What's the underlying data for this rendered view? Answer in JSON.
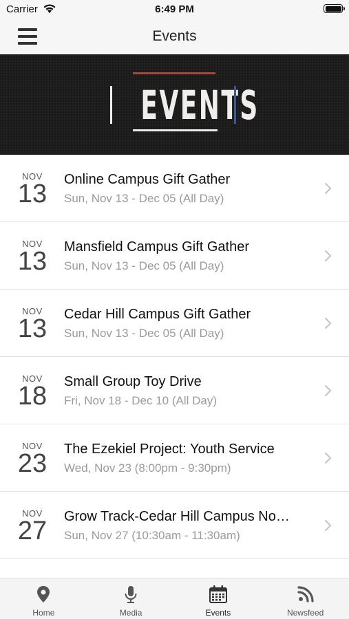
{
  "status_bar": {
    "carrier": "Carrier",
    "time": "6:49 PM"
  },
  "nav": {
    "title": "Events",
    "menu_icon": "hamburger-menu-icon"
  },
  "banner": {
    "word": "EVENTS"
  },
  "events": [
    {
      "month": "NOV",
      "day": "13",
      "title": "Online Campus Gift Gather",
      "subtitle": "Sun, Nov 13 - Dec 05 (All Day)"
    },
    {
      "month": "NOV",
      "day": "13",
      "title": "Mansfield Campus Gift Gather",
      "subtitle": "Sun, Nov 13 - Dec 05 (All Day)"
    },
    {
      "month": "NOV",
      "day": "13",
      "title": "Cedar Hill Campus Gift Gather",
      "subtitle": "Sun, Nov 13 - Dec 05 (All Day)"
    },
    {
      "month": "NOV",
      "day": "18",
      "title": "Small Group Toy Drive",
      "subtitle": "Fri, Nov 18 - Dec 10 (All Day)"
    },
    {
      "month": "NOV",
      "day": "23",
      "title": "The Ezekiel Project: Youth Service",
      "subtitle": "Wed, Nov 23 (8:00pm - 9:30pm)"
    },
    {
      "month": "NOV",
      "day": "27",
      "title": "Grow Track-Cedar Hill Campus No…",
      "subtitle": "Sun, Nov 27 (10:30am - 11:30am)"
    }
  ],
  "tabs": [
    {
      "label": "Home",
      "icon": "location-pin-icon",
      "active": false
    },
    {
      "label": "Media",
      "icon": "microphone-icon",
      "active": false
    },
    {
      "label": "Events",
      "icon": "calendar-icon",
      "active": true
    },
    {
      "label": "Newsfeed",
      "icon": "rss-feed-icon",
      "active": false
    }
  ],
  "colors": {
    "banner_bg": "#1b1b1b",
    "banner_red": "#b0442f",
    "banner_blue": "#3a5a93",
    "bar_bg": "#f6f6f6"
  }
}
